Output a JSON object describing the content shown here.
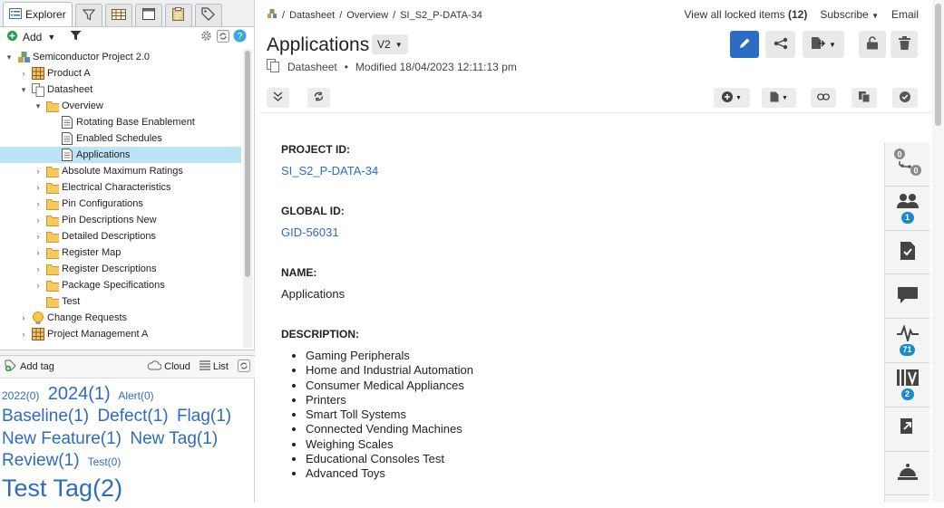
{
  "left_tabs": {
    "explorer": "Explorer"
  },
  "tree_toolbar": {
    "add": "Add"
  },
  "tree": [
    {
      "label": "Semiconductor Project 2.0",
      "depth": 0,
      "chev": "▾",
      "icon": "project-icon"
    },
    {
      "label": "Product A",
      "depth": 1,
      "chev": "›",
      "icon": "grid-icon"
    },
    {
      "label": "Datasheet",
      "depth": 1,
      "chev": "▾",
      "icon": "set-icon"
    },
    {
      "label": "Overview",
      "depth": 2,
      "chev": "▾",
      "icon": "folder-icon"
    },
    {
      "label": "Rotating Base Enablement",
      "depth": 3,
      "chev": "",
      "icon": "document-icon"
    },
    {
      "label": "Enabled Schedules",
      "depth": 3,
      "chev": "",
      "icon": "document-icon"
    },
    {
      "label": "Applications",
      "depth": 3,
      "chev": "",
      "icon": "document-icon",
      "selected": true
    },
    {
      "label": "Absolute Maximum Ratings",
      "depth": 2,
      "chev": "›",
      "icon": "folder-icon"
    },
    {
      "label": "Electrical Characteristics",
      "depth": 2,
      "chev": "›",
      "icon": "folder-icon"
    },
    {
      "label": "Pin Configurations",
      "depth": 2,
      "chev": "›",
      "icon": "folder-icon"
    },
    {
      "label": "Pin Descriptions New",
      "depth": 2,
      "chev": "›",
      "icon": "folder-icon"
    },
    {
      "label": "Detailed Descriptions",
      "depth": 2,
      "chev": "›",
      "icon": "folder-icon"
    },
    {
      "label": "Register Map",
      "depth": 2,
      "chev": "›",
      "icon": "folder-icon"
    },
    {
      "label": "Register Descriptions",
      "depth": 2,
      "chev": "›",
      "icon": "folder-icon"
    },
    {
      "label": "Package Specifications",
      "depth": 2,
      "chev": "›",
      "icon": "folder-icon"
    },
    {
      "label": "Test",
      "depth": 2,
      "chev": "",
      "icon": "folder-icon"
    },
    {
      "label": "Change Requests",
      "depth": 1,
      "chev": "›",
      "icon": "lightbulb-icon"
    },
    {
      "label": "Project Management A",
      "depth": 1,
      "chev": "›",
      "icon": "grid-icon"
    }
  ],
  "tag_toolbar": {
    "add_tag": "Add tag",
    "cloud": "Cloud",
    "list": "List"
  },
  "tags": [
    {
      "text": "2022(0)",
      "size": 12
    },
    {
      "text": "2024(1)",
      "size": 20
    },
    {
      "text": "Alert(0)",
      "size": 12
    },
    {
      "text": "Baseline(1)",
      "size": 19
    },
    {
      "text": "Defect(1)",
      "size": 19
    },
    {
      "text": "Flag(1)",
      "size": 19
    },
    {
      "text": "New Feature(1)",
      "size": 19
    },
    {
      "text": "New Tag(1)",
      "size": 19
    },
    {
      "text": "Review(1)",
      "size": 19
    },
    {
      "text": "Test(0)",
      "size": 12
    },
    {
      "text": "Test Tag(2)",
      "size": 27
    }
  ],
  "breadcrumb": {
    "items": [
      "Datasheet",
      "Overview",
      "SI_S2_P-DATA-34"
    ]
  },
  "topright": {
    "locked": "View all locked items",
    "locked_count": "(12)",
    "subscribe": "Subscribe",
    "email": "Email"
  },
  "item": {
    "title": "Applications",
    "version": "V2",
    "type": "Datasheet",
    "modified": "Modified 18/04/2023 12:11:13 pm"
  },
  "fields": {
    "project_id_label": "PROJECT ID:",
    "project_id": "SI_S2_P-DATA-34",
    "global_id_label": "GLOBAL ID:",
    "global_id": "GID-56031",
    "name_label": "NAME:",
    "name": "Applications",
    "description_label": "DESCRIPTION:",
    "description": [
      "Gaming Peripherals",
      "Home and Industrial Automation",
      "Consumer Medical Appliances",
      "Printers",
      "Smart Toll Systems",
      "Connected Vending Machines",
      "Weighing Scales",
      "Educational Consoles Test",
      "Advanced Toys"
    ]
  },
  "rightbar": {
    "trace_top": "0",
    "trace_bottom": "0",
    "reviews": "1",
    "activity": "71",
    "versions": "2"
  },
  "colors": {
    "accent": "#2e6bc1",
    "primary_button": "#2b6cc4",
    "badge": "#1b8bc8",
    "selection": "#bde4f5"
  }
}
